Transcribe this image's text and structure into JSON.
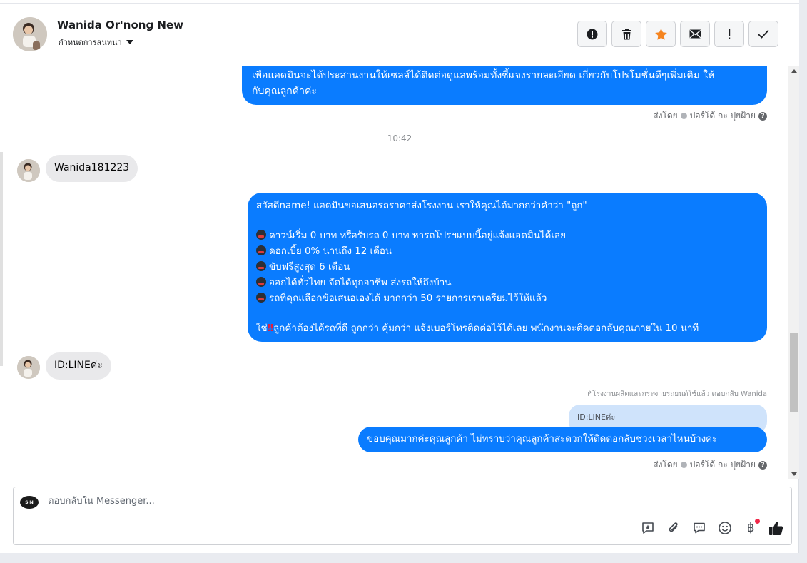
{
  "header": {
    "contact_name": "Wanida Or'nong New",
    "subtitle": "กำหนดการสนทนา",
    "actions": [
      {
        "name": "report-icon"
      },
      {
        "name": "trash-icon"
      },
      {
        "name": "star-icon"
      },
      {
        "name": "envelope-icon"
      },
      {
        "name": "exclamation-icon"
      },
      {
        "name": "checkmark-icon"
      }
    ]
  },
  "messages": {
    "msg1": {
      "line1": "เพื่อแอดมินจะได้ประสานงานให้เซลส์ได้ติดต่อดูแลพร้อมทั้งชี้แจงรายละเอียด เกี่ยวกับโปรโมชั่นดีๆเพิ่มเติม ให้",
      "line2": "กับคุณลูกค้าค่ะ"
    },
    "meta1": {
      "prefix": "ส่งโดย",
      "sender": "ปอร์โด้ กะ ปุยฝ้าย"
    },
    "time": "10:42",
    "msg2": "Wanida181223",
    "msg3": {
      "l1": "สวัสดีname! แอดมินขอเสนอรถราคาส่งโรงงาน เราให้คุณได้มากกว่าคำว่า \"ถูก\"",
      "l2": "ดาวน์เริ่ม 0 บาท หรือรับรถ 0 บาท หารถโปรฯแบบนี้อยู่แจ้งแอดมินได้เลย",
      "l3": "ดอกเบี้ย 0% นานถึง 12 เดือน",
      "l4": "ขับฟรีสูงสุด 6 เดือน",
      "l5": "ออกได้ทั่วไทย จัดได้ทุกอาชีพ ส่งรถให้ถึงบ้าน",
      "l6": "รถที่คุณเลือกข้อเสนอเองได้ มากกว่า 50 รายการเราเตรียมไว้ให้แล้ว",
      "l7_pre": "ใช่",
      "l7_bang": "‼",
      "l7_post": "ลูกค้าต้องได้รถที่ดี ถูกกว่า คุ้มกว่า แจ้งเบอร์โทรติดต่อไว้ได้เลย พนักงานจะติดต่อกลับคุณภายใน 10 นาที"
    },
    "msg4": "ID:LINEค่ะ",
    "reply_note": "↱โรงงานผลิตและกระจายรถยนต์ใช้แล้ว ตอบกลับ Wanida",
    "quoted": "ID:LINEค่ะ",
    "msg5": "ขอบคุณมากค่ะคุณลูกค้า ไม่ทราบว่าคุณลูกค้าสะดวกให้ติดต่อกลับช่วงเวลาไหนบ้างคะ",
    "meta2": {
      "prefix": "ส่งโดย",
      "sender": "ปอร์โด้ กะ ปุยฝ้าย"
    }
  },
  "composer": {
    "placeholder": "ตอบกลับใน Messenger...",
    "logo_text": "SIN",
    "baht_symbol": "฿",
    "tools": [
      "saved-reply-icon",
      "paperclip-icon",
      "speech-bubble-icon",
      "emoji-icon",
      "baht-icon",
      "thumbs-up-icon"
    ]
  },
  "colors": {
    "outgoing": "#0a7cff",
    "incoming": "#e9e9eb",
    "quoted": "#cfe3fb",
    "star": "#f5841f",
    "notification_dot": "#f02849"
  }
}
